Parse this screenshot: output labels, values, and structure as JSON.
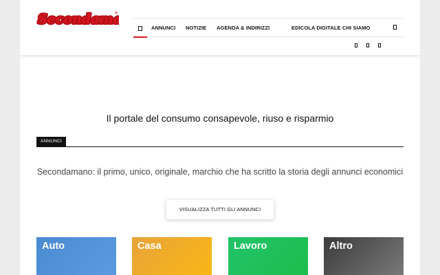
{
  "site": {
    "logo_text": "Secondamano",
    "trademark": "®"
  },
  "nav": {
    "home_icon": "home-icon",
    "items": [
      {
        "label": "ANNUNCI"
      },
      {
        "label": "NOTIZIE"
      },
      {
        "label": "AGENDA & INDIRIZZI"
      },
      {
        "label": "EDICOLA DIGITALE"
      },
      {
        "label": "CHI SIAMO"
      }
    ],
    "search_icon": "search-icon",
    "social_icons": [
      "facebook-icon",
      "instagram-icon",
      "twitter-icon"
    ]
  },
  "main": {
    "tagline": "Il portale del consumo consapevole, riuso e risparmio",
    "section_label": "ANNUNCI",
    "intro_text": "Secondamano: il primo, unico, originale, marchio che ha scritto la storia degli annunci economici",
    "cta_label": "VISUALIZZA TUTTI GLI ANNUNCI",
    "categories": [
      {
        "title": "Auto"
      },
      {
        "title": "Casa"
      },
      {
        "title": "Lavoro"
      },
      {
        "title": "Altro"
      }
    ]
  },
  "colors": {
    "brand_red": "#d8151f",
    "auto": "#4a8ad0",
    "casa": "#f2a81f",
    "lavoro": "#1fbe57",
    "altro": "#5a5a5a"
  }
}
